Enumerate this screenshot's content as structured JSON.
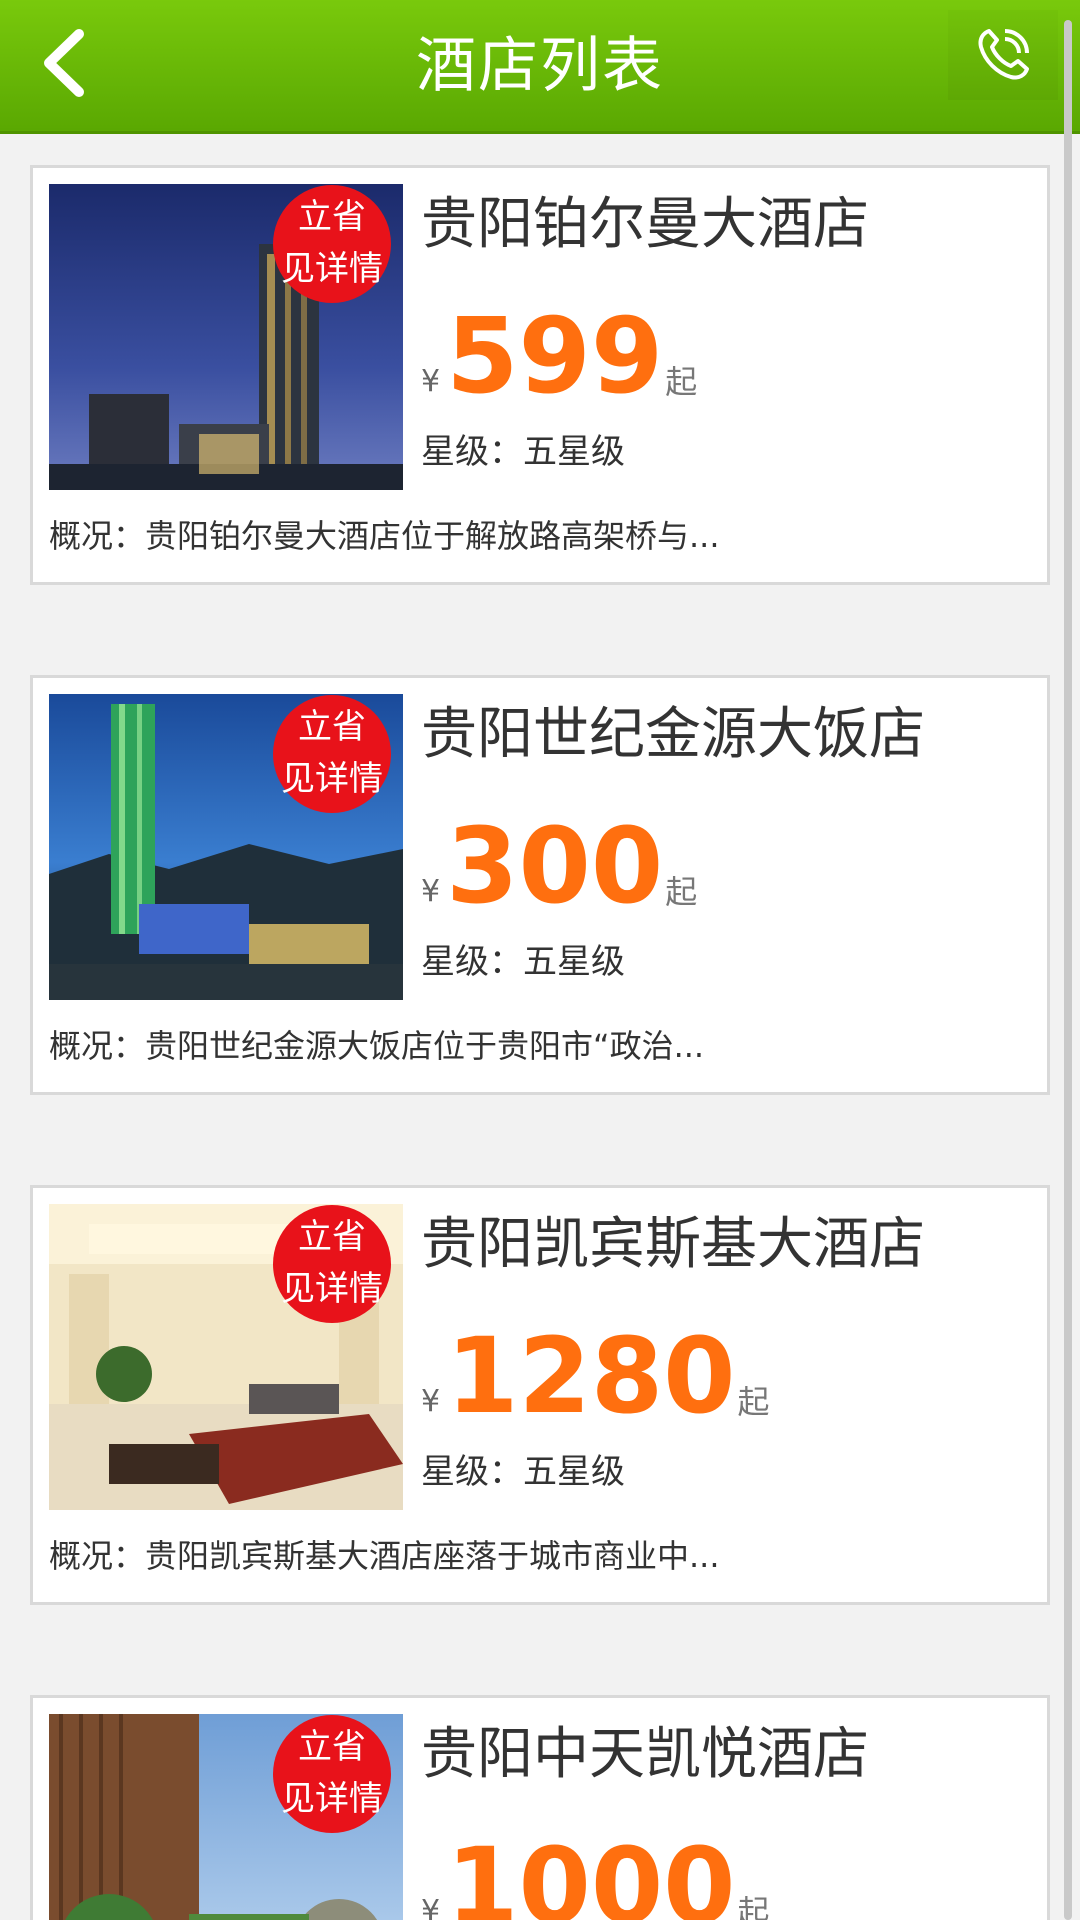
{
  "header": {
    "title": "酒店列表",
    "back_icon": "chevron-left-icon",
    "phone_icon": "phone-icon"
  },
  "colors": {
    "header_green": "#6cbf07",
    "price_orange": "#ff6f0f",
    "badge_red": "#e8121a"
  },
  "hotels": [
    {
      "badge_line1": "立省",
      "badge_line2": "见详情",
      "name": "贵阳铂尔曼大酒店",
      "currency": "¥",
      "price": "599",
      "price_suffix": "起",
      "stars": "星级：五星级",
      "summary": "概况：贵阳铂尔曼大酒店位于解放路高架桥与..."
    },
    {
      "badge_line1": "立省",
      "badge_line2": "见详情",
      "name": "贵阳世纪金源大饭店",
      "currency": "¥",
      "price": "300",
      "price_suffix": "起",
      "stars": "星级：五星级",
      "summary": "概况：贵阳世纪金源大饭店位于贵阳市“政治..."
    },
    {
      "badge_line1": "立省",
      "badge_line2": "见详情",
      "name": "贵阳凯宾斯基大酒店",
      "currency": "¥",
      "price": "1280",
      "price_suffix": "起",
      "stars": "星级：五星级",
      "summary": "概况：贵阳凯宾斯基大酒店座落于城市商业中..."
    },
    {
      "badge_line1": "立省",
      "badge_line2": "见详情",
      "name": "贵阳中天凯悦酒店",
      "currency": "¥",
      "price": "1000",
      "price_suffix": "起"
    }
  ]
}
